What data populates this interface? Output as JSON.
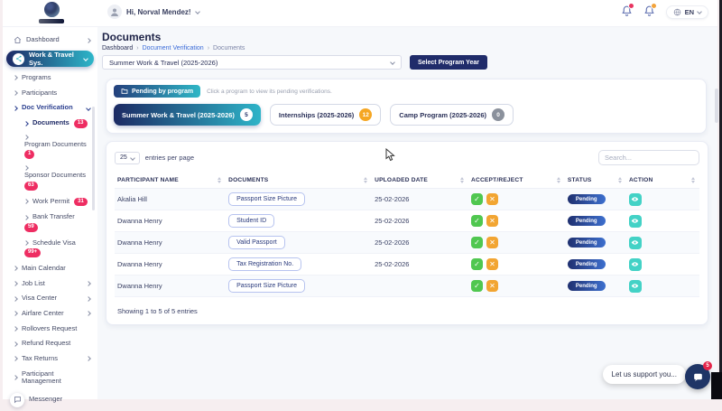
{
  "header": {
    "greeting": "Hi, Norval Mendez!",
    "language": "EN",
    "notification_badge_colors": {
      "first": "#e8345f",
      "second": "#f2a33c"
    }
  },
  "sidebar": {
    "items": {
      "dashboard": "Dashboard",
      "work_travel": "Work & Travel Sys.",
      "programs": "Programs",
      "participants": "Participants",
      "doc_verification": "Doc Verification",
      "documents": "Documents",
      "documents_badge": "13",
      "program_documents": "Program Documents",
      "program_documents_badge": "1",
      "sponsor_documents": "Sponsor Documents",
      "sponsor_documents_badge": "63",
      "work_permit": "Work Permit",
      "work_permit_badge": "31",
      "bank_transfer": "Bank Transfer",
      "bank_transfer_badge": "59",
      "schedule_visa": "Schedule Visa",
      "schedule_visa_badge": "99+",
      "main_calendar": "Main Calendar",
      "job_list": "Job List",
      "visa_center": "Visa Center",
      "airfare_center": "Airfare Center",
      "rollovers_request": "Rollovers Request",
      "refund_request": "Refund Request",
      "tax_returns": "Tax Returns",
      "participant_management": "Participant Management",
      "messenger": "Messenger"
    }
  },
  "page": {
    "title": "Documents",
    "breadcrumb1": "Dashboard",
    "breadcrumb2": "Document Verification",
    "breadcrumb3": "Documents",
    "program_select": "Summer Work & Travel (2025-2026)",
    "select_button": "Select Program Year"
  },
  "pending": {
    "pill": "Pending by program",
    "hint": "Click a program to view its pending verifications.",
    "tab1_label": "Summer Work & Travel (2025-2026)",
    "tab1_count": "5",
    "tab2_label": "Internships (2025-2026)",
    "tab2_count": "12",
    "tab3_label": "Camp Program (2025-2026)",
    "tab3_count": "0"
  },
  "table": {
    "page_size": "25",
    "entries_label": "entries per page",
    "search_placeholder": "Search...",
    "col1": "PARTICIPANT NAME",
    "col2": "DOCUMENTS",
    "col3": "UPLOADED DATE",
    "col4": "ACCEPT/REJECT",
    "col5": "STATUS",
    "col6": "ACTION",
    "rows": [
      {
        "name": "Akalia Hill",
        "document": "Passport Size Picture",
        "date": "25-02-2026",
        "status": "Pending"
      },
      {
        "name": "Dwanna Henry",
        "document": "Student ID",
        "date": "25-02-2026",
        "status": "Pending"
      },
      {
        "name": "Dwanna Henry",
        "document": "Valid Passport",
        "date": "25-02-2026",
        "status": "Pending"
      },
      {
        "name": "Dwanna Henry",
        "document": "Tax Registration No.",
        "date": "25-02-2026",
        "status": "Pending"
      },
      {
        "name": "Dwanna Henry",
        "document": "Passport Size Picture",
        "date": "",
        "status": "Pending"
      }
    ],
    "footer": "Showing 1 to 5 of 5 entries"
  },
  "support": {
    "label": "Let us support you...",
    "badge": "5"
  },
  "colors": {
    "accent_navy": "#1c2a63",
    "accent_teal": "#2eb4c8",
    "badge_red": "#ee2d62",
    "accept_green": "#50c750",
    "reject_orange": "#f2a532",
    "action_teal": "#43d2c6"
  }
}
